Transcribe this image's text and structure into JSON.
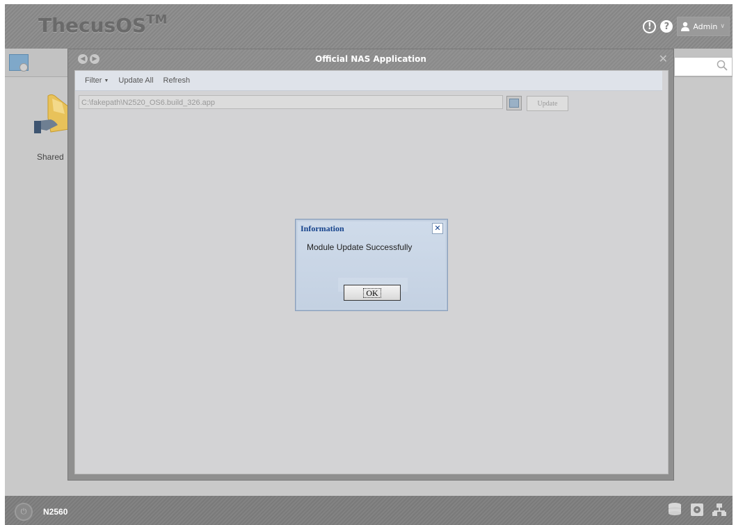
{
  "header": {
    "brand": "ThecusOS",
    "brand_tm": "TM",
    "alert_icon": "!",
    "help_icon": "?",
    "user_label": "Admin"
  },
  "desktop": {
    "icon_label": "Shared"
  },
  "app_window": {
    "title": "Official NAS Application",
    "toolbar": {
      "filter_label": "Filter",
      "update_all_label": "Update All",
      "refresh_label": "Refresh"
    },
    "file_path": "C:\\fakepath\\N2520_OS6.build_326.app",
    "update_button_label": "Update"
  },
  "dialog": {
    "title": "Information",
    "message": "Module Update Successfully",
    "ok_label": "OK"
  },
  "taskbar": {
    "device_name": "N2560"
  },
  "colors": {
    "dialog_title": "#15428b",
    "topbar_bg": "#8a8a8a",
    "window_body_bg": "#d3d3d5"
  }
}
